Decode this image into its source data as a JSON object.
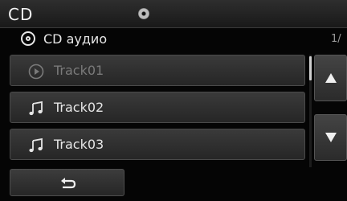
{
  "header": {
    "title": "CD"
  },
  "source": {
    "label": "CD аудио",
    "page_indicator": "1/"
  },
  "tracks": [
    {
      "label": "Track01",
      "icon": "play-circle-icon",
      "state": "playing"
    },
    {
      "label": "Track02",
      "icon": "music-note-icon",
      "state": "normal"
    },
    {
      "label": "Track03",
      "icon": "music-note-icon",
      "state": "normal"
    }
  ],
  "controls": {
    "up": "arrow-up-icon",
    "down": "arrow-down-icon",
    "back": "back-arrow-icon"
  }
}
